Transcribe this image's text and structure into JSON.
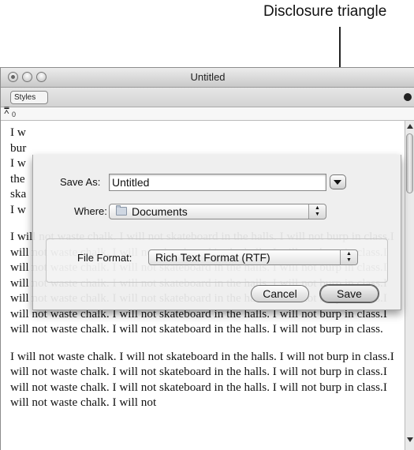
{
  "callout": {
    "text": "Disclosure triangle"
  },
  "window": {
    "title": "Untitled",
    "styles_label": "Styles"
  },
  "ruler": {
    "zero": "0"
  },
  "dialog": {
    "save_as_label": "Save As:",
    "save_as_value": "Untitled",
    "where_label": "Where:",
    "where_value": "Documents",
    "file_format_label": "File Format:",
    "file_format_value": "Rich Text Format (RTF)",
    "cancel_label": "Cancel",
    "save_label": "Save"
  },
  "document": {
    "lines_top": [
      "I w",
      "bur",
      "I w",
      "the",
      "ska",
      "I w"
    ],
    "paragraph_2": "I will not waste chalk. I will not skateboard in the halls. I will not burp in class.I will not waste chalk. I will not skateboard in the halls. I will not burp in class.I will not waste chalk. I will not skateboard in the halls. I will not burp in class.I will not waste chalk. I will not skateboard in the halls. I will not burp in class.I will not waste chalk. I will not skateboard in the halls. I will not burp in class.I will not waste chalk. I will not skateboard in the halls. I will not burp in class.I will not waste chalk. I will not skateboard in the halls. I will not burp in class.",
    "paragraph_3": "I will not waste chalk. I will not skateboard in the halls. I will not burp in class.I will not waste chalk. I will not skateboard in the halls. I will not burp in class.I will not waste chalk. I will not skateboard in the halls. I will not burp in class.I will not waste chalk. I will not"
  },
  "colors": {
    "window_chrome": "#d0d0d0",
    "sheet_bg": "#eeeeee",
    "text": "#111111"
  }
}
